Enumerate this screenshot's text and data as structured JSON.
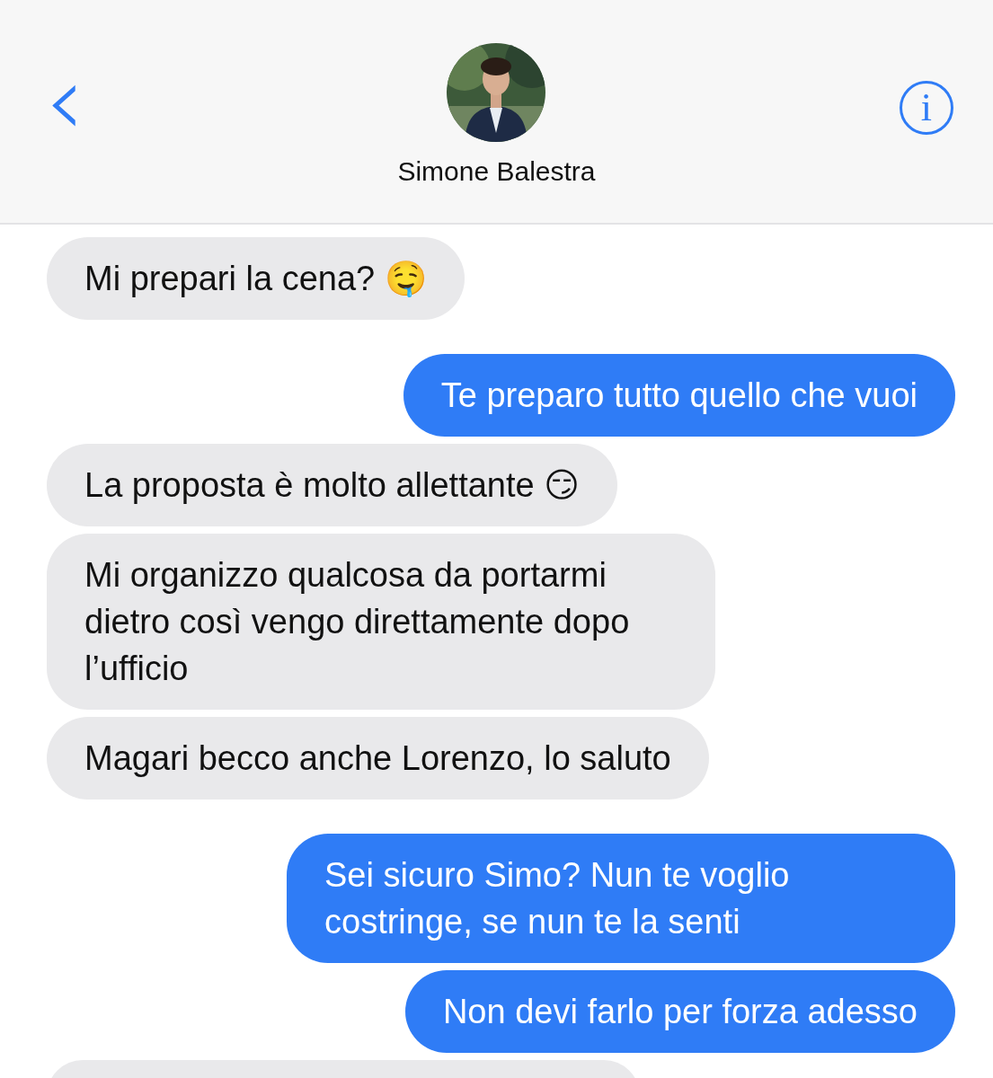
{
  "header": {
    "back": "‹",
    "contact_name": "Simone Balestra",
    "info": "i"
  },
  "messages": [
    {
      "kind": "incoming",
      "text": "Mi prepari la cena? 🤤"
    },
    {
      "kind": "outgoing",
      "text": "Te preparo tutto quello che vuoi"
    },
    {
      "kind": "incoming",
      "text": "La proposta è molto allettante 😏"
    },
    {
      "kind": "incoming",
      "text": "Mi organizzo qualcosa da portarmi dietro così vengo direttamente dopo l’ufficio"
    },
    {
      "kind": "incoming",
      "text": "Magari becco anche Lorenzo, lo saluto"
    },
    {
      "kind": "outgoing",
      "text": "Sei sicuro Simo? Nun te voglio costringe, se nun te la senti"
    },
    {
      "kind": "outgoing",
      "text": "Non devi farlo per forza adesso"
    },
    {
      "kind": "partial"
    }
  ]
}
